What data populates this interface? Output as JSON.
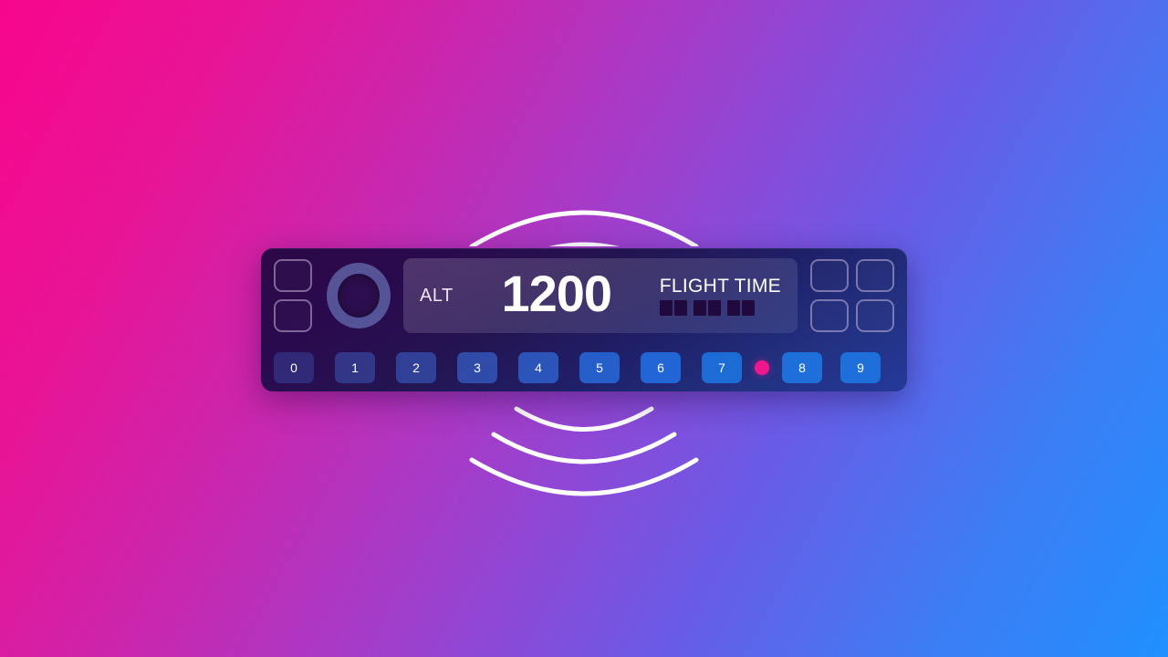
{
  "background": {
    "gradient_from": "#f7068c",
    "gradient_mid": "#9b41cf",
    "gradient_to": "#2090ff",
    "angle_deg": 118
  },
  "signal_waves": {
    "top": {
      "name": "signal-arcs-up",
      "arc_count": 3,
      "color": "#ffffff",
      "stroke_width": 5
    },
    "bottom": {
      "name": "signal-arcs-down",
      "arc_count": 3,
      "color": "#ffffff",
      "stroke_width": 5
    }
  },
  "device": {
    "name": "drone-remote-controller",
    "panel_color_top": "#2c0847",
    "panel_color_bottom": "#24399a",
    "left_buttons": [
      {
        "label": "",
        "name": "left-button-1"
      },
      {
        "label": "",
        "name": "left-button-2"
      }
    ],
    "knob": {
      "label": "",
      "name": "rotary-knob",
      "ring_color": "#768cd2"
    },
    "screen": {
      "alt_label": "ALT",
      "alt_value": "1200",
      "flight_time_label": "FLIGHT TIME",
      "flight_time_segments": 6,
      "segment_color": "#20093c"
    },
    "right_buttons": [
      {
        "label": "",
        "name": "right-button-1"
      },
      {
        "label": "",
        "name": "right-button-2"
      },
      {
        "label": "",
        "name": "right-button-3"
      },
      {
        "label": "",
        "name": "right-button-4"
      }
    ],
    "keypad": {
      "keys": [
        {
          "label": "0",
          "width": 44,
          "gap_after": 23,
          "bg": "rgba(70,110,215,0.30)"
        },
        {
          "label": "1",
          "width": 44,
          "gap_after": 23,
          "bg": "rgba(70,112,218,0.40)"
        },
        {
          "label": "2",
          "width": 44,
          "gap_after": 23,
          "bg": "rgba(62,110,220,0.50)"
        },
        {
          "label": "3",
          "width": 44,
          "gap_after": 23,
          "bg": "rgba(56,110,222,0.60)"
        },
        {
          "label": "4",
          "width": 44,
          "gap_after": 23,
          "bg": "rgba(48,110,224,0.70)"
        },
        {
          "label": "5",
          "width": 44,
          "gap_after": 23,
          "bg": "rgba(40,110,226,0.80)"
        },
        {
          "label": "6",
          "width": 44,
          "gap_after": 23,
          "bg": "rgba(34,110,228,0.88)"
        },
        {
          "label": "7",
          "width": 44,
          "gap_after": 14,
          "bg": "rgba(30,111,217,0.95)"
        }
      ],
      "indicator": {
        "name": "status-led",
        "color": "#f0178c",
        "gap_after": 14
      },
      "keys_after": [
        {
          "label": "8",
          "width": 44,
          "gap_after": 20,
          "bg": "#1e6fd9"
        },
        {
          "label": "9",
          "width": 44,
          "gap_after": 0,
          "bg": "#1e6fd9"
        }
      ]
    }
  }
}
